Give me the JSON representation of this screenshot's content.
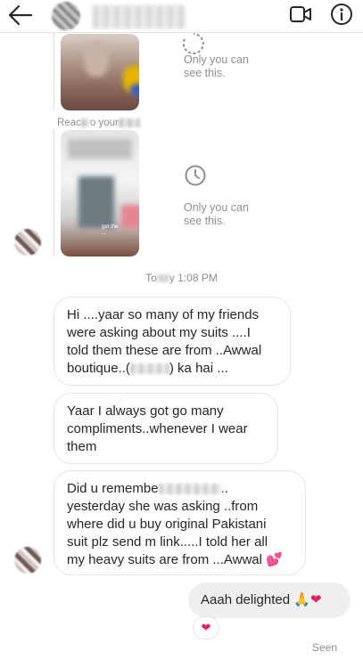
{
  "header": {
    "back_icon": "arrow-left-icon",
    "video_icon": "video-camera-icon",
    "info_icon": "info-circle-icon"
  },
  "story_replies": [
    {
      "note": "Only you can see this.",
      "icon": "clock-icon"
    },
    {
      "note": "Only you can see this.",
      "icon": "clock-icon"
    }
  ],
  "react_label": {
    "prefix": "Reac",
    "mid": "o your",
    "suffix": ""
  },
  "timestamp": {
    "prefix": "To",
    "suffix": "y 1:08 PM"
  },
  "messages": [
    {
      "lines": [
        "Hi ....yaar so many of my friends",
        "were asking about my suits ....I",
        "told them these are from ..Awwal"
      ],
      "last_prefix": "boutique..(",
      "last_suffix": ") ka hai ..."
    },
    {
      "lines": [
        "Yaar I always got go many",
        "compliments..whenever I wear",
        "them"
      ]
    },
    {
      "first_prefix": "Did u remembe",
      "first_suffix": "..",
      "lines": [
        "yesterday she was asking ..from",
        "where did u buy original Pakistani",
        "suit plz send m link.....I told her all",
        "my heavy suits are from ...Awwal"
      ],
      "emoji": "💕"
    }
  ],
  "my_message": {
    "text": "Aaah delighted",
    "emojis": [
      "🙏",
      "❤"
    ]
  },
  "reaction": "❤",
  "status": "Seen",
  "colors": {
    "accent_heart": "#e0245e",
    "my_bubble": "#efefef",
    "border": "#e6e6e6"
  }
}
